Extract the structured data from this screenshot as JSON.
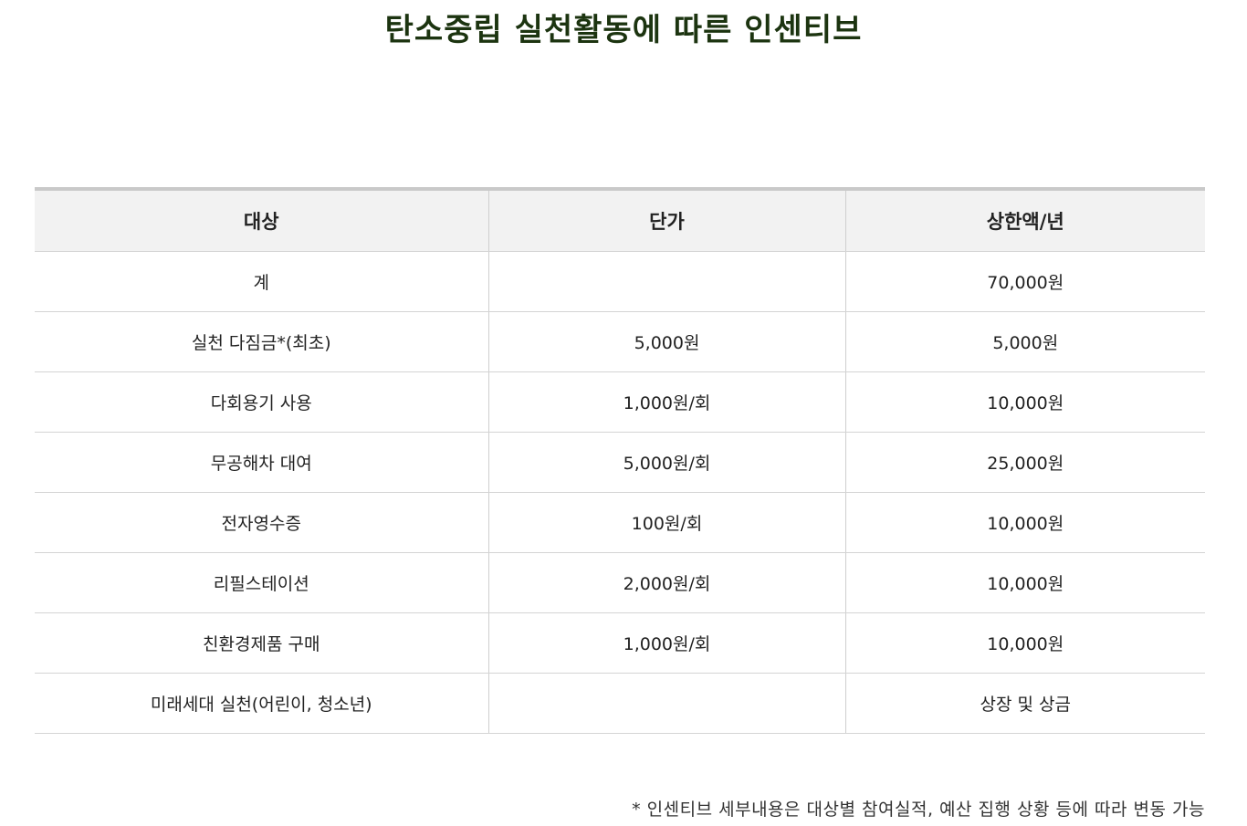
{
  "title": "탄소중립 실천활동에 따른 인센티브",
  "table": {
    "headers": [
      "대상",
      "단가",
      "상한액/년"
    ],
    "rows": [
      [
        "계",
        "",
        "70,000원"
      ],
      [
        "실천 다짐금*(최초)",
        "5,000원",
        "5,000원"
      ],
      [
        "다회용기 사용",
        "1,000원/회",
        "10,000원"
      ],
      [
        "무공해차 대여",
        "5,000원/회",
        "25,000원"
      ],
      [
        "전자영수증",
        "100원/회",
        "10,000원"
      ],
      [
        "리필스테이션",
        "2,000원/회",
        "10,000원"
      ],
      [
        "친환경제품 구매",
        "1,000원/회",
        "10,000원"
      ],
      [
        "미래세대 실천(어린이, 청소년)",
        "",
        "상장 및 상금"
      ]
    ]
  },
  "footnote": "* 인센티브 세부내용은 대상별 참여실적, 예산 집행 상황 등에 따라 변동 가능",
  "colors": {
    "title": "#1c3410",
    "header_bg": "#f2f2f2",
    "top_border": "#c9c9c9"
  }
}
